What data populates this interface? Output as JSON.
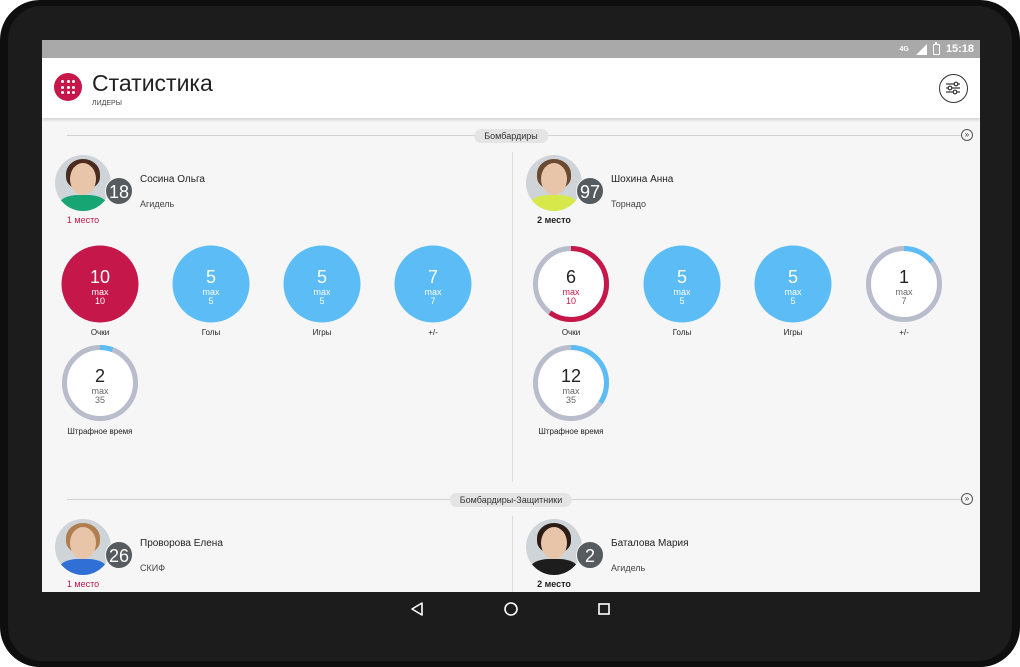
{
  "status": {
    "time": "15:18",
    "network": "4G"
  },
  "header": {
    "title": "Статистика",
    "subtitle": "ЛИДЕРЫ"
  },
  "colors": {
    "accent": "#c5174a",
    "blue": "#5bbcf6",
    "ring": "#b8bccb",
    "badge": "#555b5e"
  },
  "sections": [
    {
      "title": "Бомбардиры",
      "players": [
        {
          "number": "18",
          "name": "Сосина Ольга",
          "team": "Агидель",
          "place": "1 место",
          "hair": "#4a2b20",
          "shirt": "#17a673",
          "stats": [
            {
              "value": "10",
              "max_label": "max",
              "max": "10",
              "label": "Очки",
              "style": "solid-red",
              "fraction": 1.0
            },
            {
              "value": "5",
              "max_label": "max",
              "max": "5",
              "label": "Голы",
              "style": "solid-blue",
              "fraction": 1.0
            },
            {
              "value": "5",
              "max_label": "max",
              "max": "5",
              "label": "Игры",
              "style": "solid-blue",
              "fraction": 1.0
            },
            {
              "value": "7",
              "max_label": "max",
              "max": "7",
              "label": "+/-",
              "style": "solid-blue",
              "fraction": 1.0
            },
            {
              "value": "2",
              "max_label": "max",
              "max": "35",
              "label": "Штрафное время",
              "style": "ring-blue",
              "fraction": 0.057
            }
          ]
        },
        {
          "number": "97",
          "name": "Шохина Анна",
          "team": "Торнадо",
          "place": "2 место",
          "hair": "#6b4a32",
          "shirt": "#d7e84a",
          "stats": [
            {
              "value": "6",
              "max_label": "max",
              "max": "10",
              "label": "Очки",
              "style": "ring-red",
              "fraction": 0.6
            },
            {
              "value": "5",
              "max_label": "max",
              "max": "5",
              "label": "Голы",
              "style": "solid-blue",
              "fraction": 1.0
            },
            {
              "value": "5",
              "max_label": "max",
              "max": "5",
              "label": "Игры",
              "style": "solid-blue",
              "fraction": 1.0
            },
            {
              "value": "1",
              "max_label": "max",
              "max": "7",
              "label": "+/-",
              "style": "ring-blue",
              "fraction": 0.143
            },
            {
              "value": "12",
              "max_label": "max",
              "max": "35",
              "label": "Штрафное время",
              "style": "ring-blue",
              "fraction": 0.343
            }
          ]
        }
      ]
    },
    {
      "title": "Бомбардиры-Защитники",
      "players": [
        {
          "number": "26",
          "name": "Проворова Елена",
          "team": "СКИФ",
          "place": "1 место",
          "hair": "#b07d4e",
          "shirt": "#2f6fd6",
          "stats": []
        },
        {
          "number": "2",
          "name": "Баталова Мария",
          "team": "Агидель",
          "place": "2 место",
          "hair": "#2b1d16",
          "shirt": "#1d1d1d",
          "stats": []
        }
      ]
    }
  ]
}
